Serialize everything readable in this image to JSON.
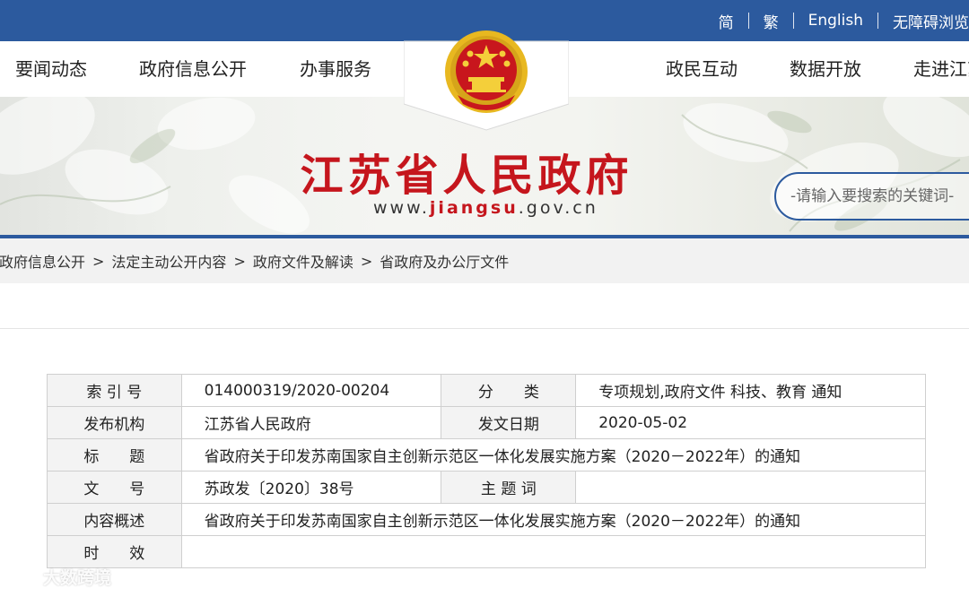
{
  "top_links": [
    "简",
    "繁",
    "English",
    "无障碍浏览"
  ],
  "nav": {
    "left": [
      "要闻动态",
      "政府信息公开",
      "办事服务"
    ],
    "right": [
      "政民互动",
      "数据开放",
      "走进江苏"
    ]
  },
  "banner": {
    "title": "江苏省人民政府",
    "url_prefix": "www.",
    "url_bold": "jiangsu",
    "url_suffix": ".gov.cn",
    "search_placeholder": "-请输入要搜索的关键词-"
  },
  "breadcrumb": [
    "政府信息公开",
    "法定主动公开内容",
    "政府文件及解读",
    "省政府及办公厅文件"
  ],
  "info": {
    "index_label": "索 引 号",
    "index_value": "014000319/2020-00204",
    "category_label": "分　　类",
    "category_value": "专项规划,政府文件 科技、教育 通知",
    "publisher_label": "发布机构",
    "publisher_value": "江苏省人民政府",
    "date_label": "发文日期",
    "date_value": "2020-05-02",
    "title_label": "标　　题",
    "title_value": "省政府关于印发苏南国家自主创新示范区一体化发展实施方案（2020－2022年）的通知",
    "docno_label": "文　　号",
    "docno_value": "苏政发〔2020〕38号",
    "subject_label": "主 题 词",
    "subject_value": "",
    "summary_label": "内容概述",
    "summary_value": "省政府关于印发苏南国家自主创新示范区一体化发展实施方案（2020－2022年）的通知",
    "validity_label": "时　　效",
    "validity_value": ""
  },
  "watermark": "大数跨境",
  "colors": {
    "brand_blue": "#2c5a9e",
    "title_red": "#c5161d",
    "emblem_gold": "#e8b820"
  }
}
